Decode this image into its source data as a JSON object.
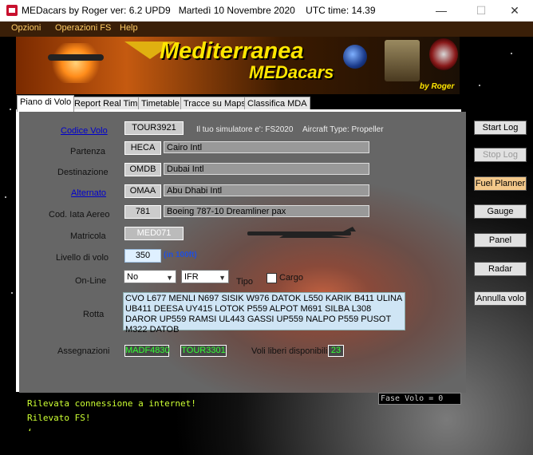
{
  "window": {
    "title": "MEDacars by Roger ver: 6.2 UPD9   Martedì 10 Novembre 2020    UTC time: 14.39",
    "min": "—",
    "max": "☐",
    "close": "✕"
  },
  "menu": [
    "Opzioni",
    "Operazioni FS",
    "Help"
  ],
  "banner": {
    "title": "Mediterranea",
    "subtitle": "MEDacars",
    "by": "by Roger"
  },
  "tabs": [
    "Piano di Volo",
    "Report Real Time",
    "Timetable",
    "Tracce su Maps",
    "Classifica MDA"
  ],
  "form": {
    "codice_volo": {
      "label": "Codice Volo",
      "value": "TOUR3921"
    },
    "simulator_info": "Il tuo simulatore e': FS2020",
    "aircraft_type": "Aircraft Type: Propeller",
    "partenza": {
      "label": "Partenza",
      "code": "HECA",
      "name": "Cairo Intl"
    },
    "destinazione": {
      "label": "Destinazione",
      "code": "OMDB",
      "name": "Dubai Intl"
    },
    "alternato": {
      "label": "Alternato",
      "code": "OMAA",
      "name": "Abu Dhabi Intl"
    },
    "cod_iata": {
      "label": "Cod. Iata Aereo",
      "code": "781",
      "name": "Boeing 787-10 Dreamliner pax"
    },
    "matricola": {
      "label": "Matricola",
      "value": "MED071"
    },
    "livello": {
      "label": "Livello di volo",
      "value": "350",
      "hint": "(in 100ft)"
    },
    "online": {
      "label": "On-Line",
      "value": "No",
      "rules": "IFR",
      "tipo": "Tipo",
      "cargo": "Cargo"
    },
    "rotta": {
      "label": "Rotta",
      "value": "CVO L677 MENLI N697 SISIK W976 DATOK L550 KARIK B411 ULINA UB411 DEESA UY415 LOTOK P559 ALPOT M691 SILBA L308 DAROR UP559 RAMSI UL443 GASSI UP559 NALPO P559 PUSOT M322 DATOB"
    },
    "assegnazioni": {
      "label": "Assegnazioni",
      "a1": "MADF4830",
      "a2": "TOUR3301",
      "voli_label": "Voli liberi disponibili",
      "voli_value": "23"
    }
  },
  "side_buttons": {
    "start_log": "Start Log",
    "stop_log": "Stop Log",
    "fuel_planner": "Fuel Planner",
    "gauge": "Gauge",
    "panel": "Panel",
    "radar": "Radar",
    "annulla_volo": "Annulla volo"
  },
  "status": {
    "fase_volo": "Fase Volo = 0"
  },
  "console": [
    "Rilevata connessione a internet!",
    "Rilevato FS!",
    "ʻ"
  ]
}
